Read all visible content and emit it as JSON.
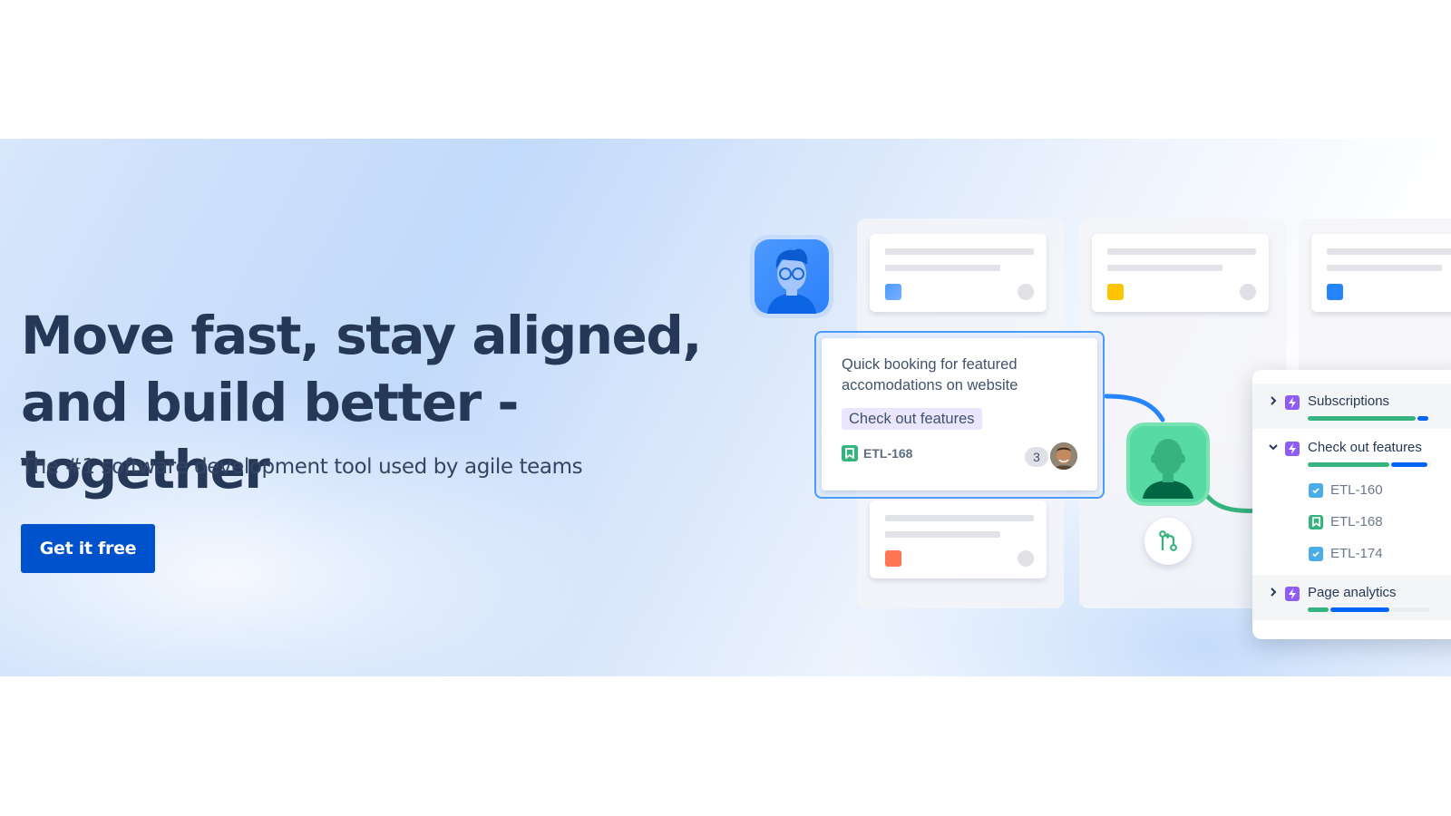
{
  "hero": {
    "headline_line1": "Move fast, stay aligned,",
    "headline_line2": "and build better - together",
    "subheadline": "The #1 software development tool used by agile teams",
    "cta_label": "Get it free",
    "colors": {
      "cta": "#0052cc",
      "headline": "#253858"
    }
  },
  "illustration": {
    "placeholder_cards": [
      {
        "status_color": "#4c9aff"
      },
      {
        "status_color": "#ffc400"
      },
      {
        "status_color": "#2684ff"
      },
      {
        "status_color": "#ff7452"
      }
    ],
    "focus_card": {
      "title": "Quick booking for featured accomodations on website",
      "tag": "Check out features",
      "issue_key": "ETL-168",
      "issue_type_icon": "story-bookmark-icon",
      "comment_count": "3"
    },
    "epics": [
      {
        "label": "Subscriptions",
        "expanded": false,
        "progress": {
          "done": 0.88,
          "in_progress": 0.1,
          "todo": 0.02
        }
      },
      {
        "label": "Check out features",
        "expanded": true,
        "progress": {
          "done": 0.67,
          "in_progress": 0.31,
          "todo": 0.02
        },
        "children": [
          {
            "key": "ETL-160",
            "type": "task"
          },
          {
            "key": "ETL-168",
            "type": "story"
          },
          {
            "key": "ETL-174",
            "type": "task"
          }
        ]
      },
      {
        "label": "Page analytics",
        "expanded": false,
        "progress": {
          "done": 0.18,
          "in_progress": 0.49,
          "todo": 0.33
        }
      }
    ],
    "progress_colors": {
      "done": "#36b37e",
      "in_progress": "#0065ff",
      "todo": "#ebecf0"
    }
  }
}
